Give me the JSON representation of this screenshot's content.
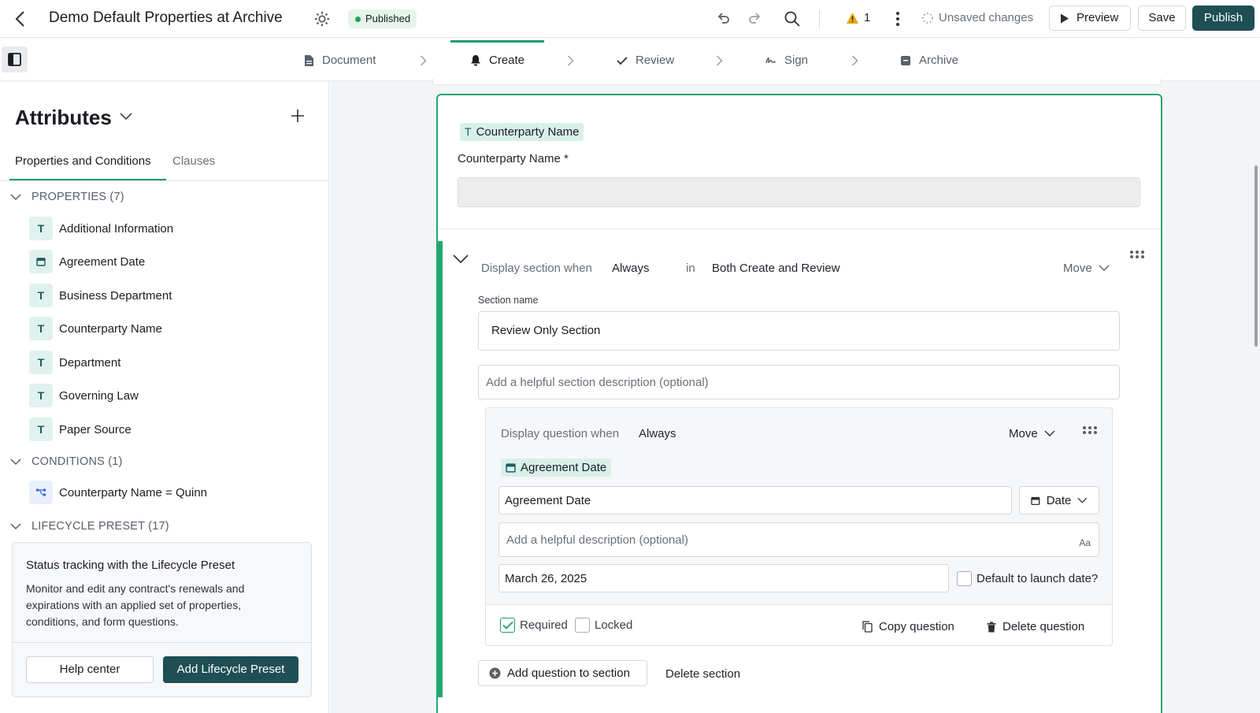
{
  "header": {
    "title": "Demo Default Properties at Archive",
    "status_badge": "Published",
    "warning_count": "1",
    "save_state": "Unsaved changes",
    "preview_label": "Preview",
    "save_label": "Save",
    "publish_label": "Publish"
  },
  "stepper": {
    "steps": [
      {
        "label": "Document",
        "icon": "document-icon"
      },
      {
        "label": "Create",
        "icon": "bell-icon",
        "active": true
      },
      {
        "label": "Review",
        "icon": "check-icon"
      },
      {
        "label": "Sign",
        "icon": "signature-icon"
      },
      {
        "label": "Archive",
        "icon": "archive-icon"
      }
    ]
  },
  "sidebar": {
    "title": "Attributes",
    "tabs": [
      "Properties and Conditions",
      "Clauses"
    ],
    "properties_header": "PROPERTIES (7)",
    "properties": [
      {
        "label": "Additional Information",
        "type": "T"
      },
      {
        "label": "Agreement Date",
        "type": "date"
      },
      {
        "label": "Business Department",
        "type": "T"
      },
      {
        "label": "Counterparty Name",
        "type": "T"
      },
      {
        "label": "Department",
        "type": "T"
      },
      {
        "label": "Governing Law",
        "type": "T"
      },
      {
        "label": "Paper Source",
        "type": "T"
      }
    ],
    "conditions_header": "CONDITIONS (1)",
    "conditions": [
      {
        "label": "Counterparty Name = Quinn"
      }
    ],
    "lifecycle_header": "LIFECYCLE PRESET (17)",
    "preset_card": {
      "title": "Status tracking with the Lifecycle Preset",
      "body": "Monitor and edit any contract's renewals and expirations with an applied set of properties, conditions, and form questions.",
      "help_label": "Help center",
      "add_label": "Add Lifecycle Preset"
    }
  },
  "main": {
    "counterparty_pill": "Counterparty Name",
    "counterparty_label": "Counterparty Name *",
    "section": {
      "display_label": "Display section when",
      "display_value": "Always",
      "in_label": "in",
      "in_value": "Both Create and Review",
      "move_label": "Move",
      "name_label": "Section name",
      "name_value": "Review Only Section",
      "description_placeholder": "Add a helpful section description (optional)",
      "add_question_label": "Add question to section",
      "delete_section_label": "Delete section"
    },
    "question": {
      "display_label": "Display question when",
      "display_value": "Always",
      "move_label": "Move",
      "pill": "Agreement Date",
      "name_value": "Agreement Date",
      "type_label": "Date",
      "description_placeholder": "Add a helpful description (optional)",
      "aa_label": "Aa",
      "default_value": "March 26, 2025",
      "launch_label": "Default to launch date?",
      "required_label": "Required",
      "locked_label": "Locked",
      "copy_label": "Copy question",
      "delete_label": "Delete question"
    }
  },
  "colors": {
    "accent_green": "#24a773",
    "brand_teal": "#1d4f55",
    "pill_teal": "#d8f0ea",
    "warning": "#e8a800"
  }
}
